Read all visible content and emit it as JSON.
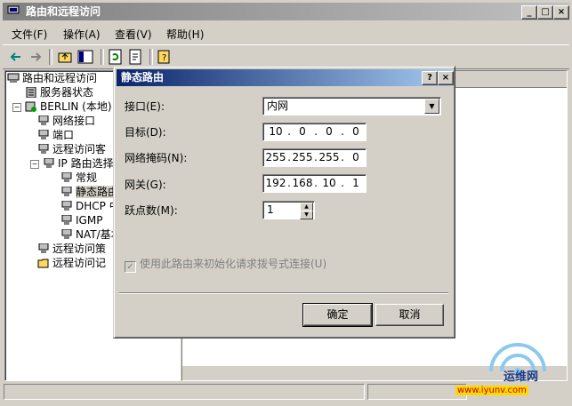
{
  "main": {
    "title": "路由和远程访问",
    "menu": [
      "文件(F)",
      "操作(A)",
      "查看(V)",
      "帮助(H)"
    ],
    "controls": {
      "minimize": "_",
      "maximize": "□",
      "close": "×"
    }
  },
  "tree": {
    "items": [
      {
        "label": "路由和远程访问"
      },
      {
        "label": "服务器状态"
      },
      {
        "label": "BERLIN (本地)",
        "expander": "−"
      },
      {
        "label": "网络接口"
      },
      {
        "label": "端口"
      },
      {
        "label": "远程访问客"
      },
      {
        "label": "IP 路由选择",
        "expander": "−"
      },
      {
        "label": "常规"
      },
      {
        "label": "静态路由"
      },
      {
        "label": "DHCP 中"
      },
      {
        "label": "IGMP"
      },
      {
        "label": "NAT/基本"
      },
      {
        "label": "远程访问策"
      },
      {
        "label": "远程访问记"
      }
    ]
  },
  "dialog": {
    "title": "静态路由",
    "help_btn": "?",
    "close_btn": "×",
    "interface_label": "接口(E):",
    "interface_value": "内网",
    "dest_label": "目标(D):",
    "dest_ip": [
      "10",
      "0",
      "0",
      "0"
    ],
    "mask_label": "网络掩码(N):",
    "mask_ip": [
      "255",
      "255",
      "255",
      "0"
    ],
    "gateway_label": "网关(G):",
    "gateway_ip": [
      "192",
      "168",
      "10",
      "1"
    ],
    "hops_label": "跃点数(M):",
    "hops_value": "1",
    "checkbox_label": "使用此路由来初始化请求拨号式连接(U)",
    "checkbox_mark": "✓",
    "ok": "确定",
    "cancel": "取消"
  },
  "watermark": {
    "line1": "运维网",
    "line2": "www.iyunv.com"
  }
}
